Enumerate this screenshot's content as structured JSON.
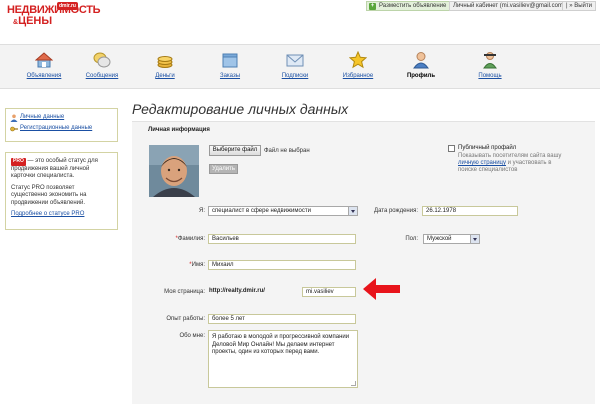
{
  "header": {
    "logo_line1": "НЕДВИЖИМОСТЬ",
    "logo_amp": "&",
    "logo_line2": "ЦЕНЫ",
    "logo_badge": "dmir.ru",
    "post_ad": "Разместить объявление",
    "cabinet": "Личный кабинет (mi.vasiliev@gmail.com)",
    "logout": "| » Выйти"
  },
  "nav": {
    "items": [
      {
        "label": "Объявления",
        "icon": "house-icon"
      },
      {
        "label": "Сообщения",
        "icon": "speech-bubbles-icon"
      },
      {
        "label": "Деньги",
        "icon": "coins-icon"
      },
      {
        "label": "Заказы",
        "icon": "box-icon"
      },
      {
        "label": "Подписки",
        "icon": "envelope-icon"
      },
      {
        "label": "Избранное",
        "icon": "star-icon"
      },
      {
        "label": "Профиль",
        "icon": "person-icon"
      },
      {
        "label": "Помощь",
        "icon": "help-icon"
      }
    ],
    "active": "Профиль"
  },
  "sidebar": {
    "links": [
      {
        "label": "Личные данные",
        "icon": "person-icon"
      },
      {
        "label": "Регистрационные данные",
        "icon": "key-icon"
      }
    ],
    "pro": {
      "badge": "PRO",
      "text1": " — это особый статус для продвижения вашей личной карточки специалиста.",
      "text2": "Статус PRO позволяет существенно экономить на продвижении объявлений.",
      "link": "Подробнее о статусе PRO"
    }
  },
  "main": {
    "title": "Редактирование личных данных",
    "section": "Личная информация",
    "choose_file": "Выберите файл",
    "no_file": "Файл не выбран",
    "delete": "Удалить",
    "public_profile": "Публичный профайл",
    "public_desc_1": "Показывать посетителям сайта вашу",
    "public_desc_link": "личную страницу",
    "public_desc_2": " и участвовать в поиске специалистов",
    "fields": {
      "role_label": "Я:",
      "role_value": "специалист в сфере недвижимости",
      "birth_label": "Дата рождения:",
      "birth_value": "26.12.1978",
      "surname_label": "Фамилия:",
      "surname_value": "Васильев",
      "gender_label": "Пол:",
      "gender_value": "Мужской",
      "name_label": "Имя:",
      "name_value": "Михаил",
      "page_label": "Моя страница:",
      "page_prefix": "http://realty.dmir.ru/",
      "page_value": "mi.vasiliev",
      "experience_label": "Опыт работы:",
      "experience_value": "более 5 лет",
      "about_label": "Обо мне:",
      "about_value": "Я работаю в молодой и прогрессивной компании Деловой Мир Онлайн! Мы делаем интернет проекты, один из которых перед вами."
    },
    "required_mark": "*"
  },
  "colors": {
    "brand_red": "#d42121",
    "link_blue": "#1a4fa3",
    "field_border": "#c8c89a",
    "panel_bg": "#f4f4f4"
  }
}
